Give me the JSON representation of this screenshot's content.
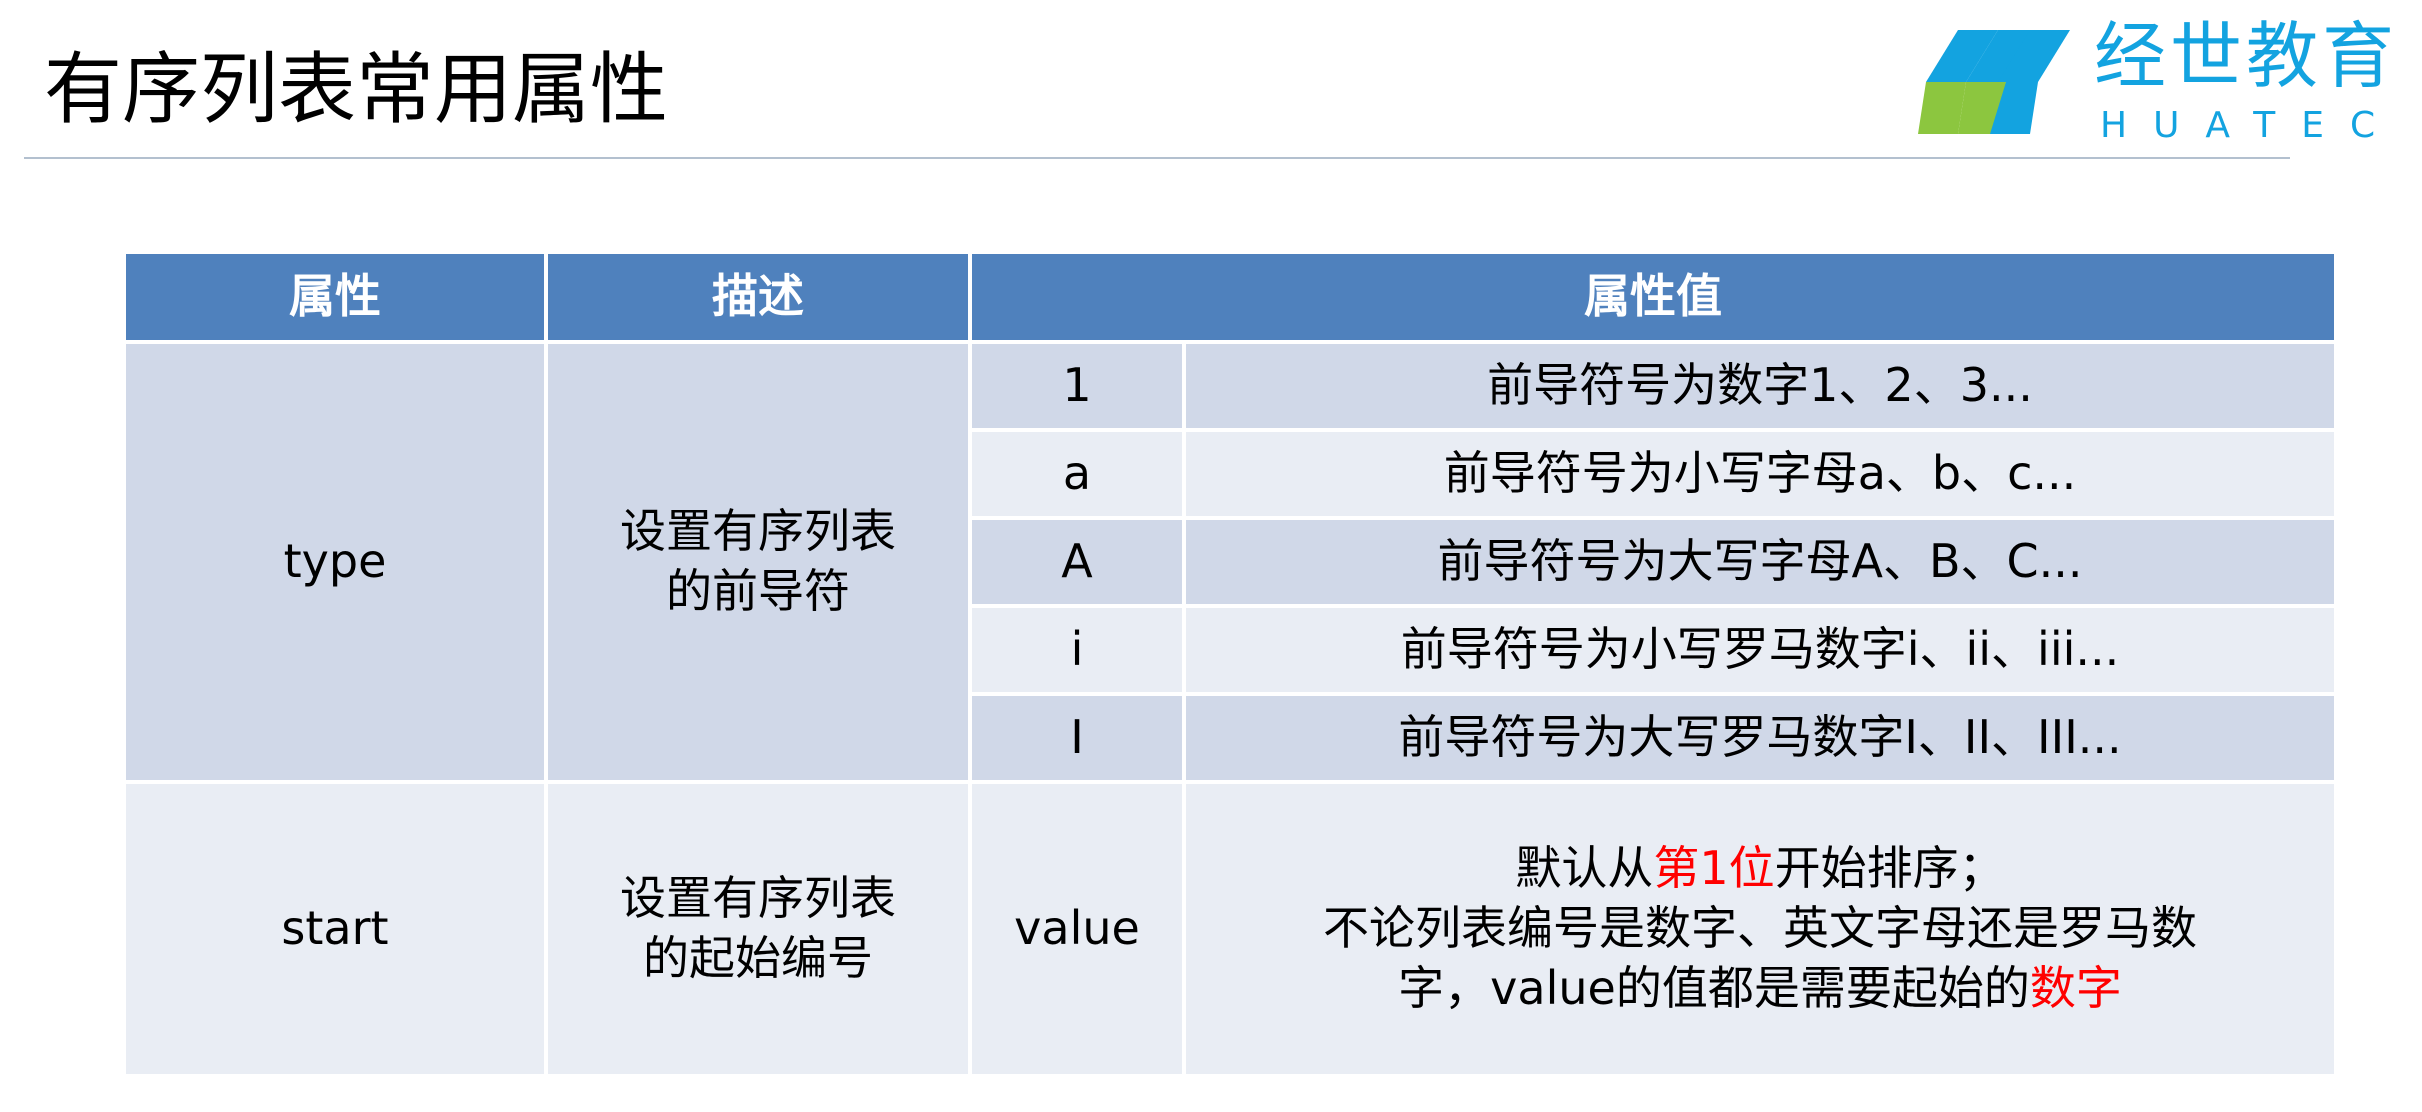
{
  "slide": {
    "title": "有序列表常用属性",
    "logo": {
      "cn": "经世教育",
      "en": "HUATEC",
      "colors": {
        "primary": "#13a3e0",
        "accent": "#8cc63f"
      }
    }
  },
  "table": {
    "headers": [
      "属性",
      "描述",
      "属性值"
    ],
    "type_row": {
      "attr": "type",
      "desc_line1": "设置有序列表",
      "desc_line2": "的前导符",
      "values": [
        {
          "value": "1",
          "meaning": "前导符号为数字1、2、3..."
        },
        {
          "value": "a",
          "meaning": "前导符号为小写字母a、b、c..."
        },
        {
          "value": "A",
          "meaning": "前导符号为大写字母A、B、C..."
        },
        {
          "value": "i",
          "meaning": "前导符号为小写罗马数字i、ii、iii..."
        },
        {
          "value": "I",
          "meaning": "前导符号为大写罗马数字I、II、III..."
        }
      ]
    },
    "start_row": {
      "attr": "start",
      "desc_line1": "设置有序列表",
      "desc_line2": "的起始编号",
      "value": "value",
      "line1_pre": "默认从",
      "line1_hl": "第1位",
      "line1_post": "开始排序；",
      "line2": "不论列表编号是数字、英文字母还是罗马数",
      "line3_pre": "字，value的值都是需要起始的",
      "line3_hl": "数字"
    }
  },
  "colors": {
    "header_bg": "#4f81bd",
    "row_dark": "#d0d8e8",
    "row_light": "#e9edf4",
    "highlight": "#ff0000"
  }
}
